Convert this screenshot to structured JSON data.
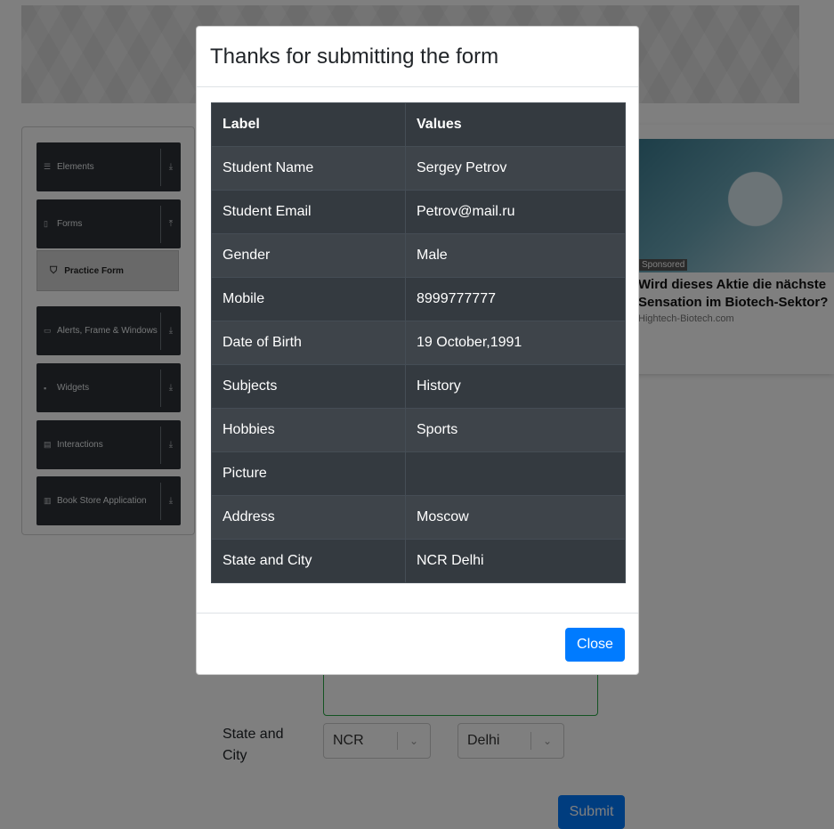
{
  "sidebar": {
    "groups": [
      {
        "label": "Elements",
        "icon": "hamburger-icon",
        "glyph": "☰",
        "arrow": "⤓"
      },
      {
        "label": "Forms",
        "icon": "document-icon",
        "glyph": "▯",
        "arrow": "⤒"
      },
      {
        "label": "Alerts, Frame & Windows",
        "icon": "window-icon",
        "glyph": "▭",
        "arrow": "⤓"
      },
      {
        "label": "Widgets",
        "icon": "grid-icon",
        "glyph": "▪",
        "arrow": "⤓"
      },
      {
        "label": "Interactions",
        "icon": "interactions-icon",
        "glyph": "▤",
        "arrow": "⤓"
      },
      {
        "label": "Book Store Application",
        "icon": "books-icon",
        "glyph": "▥",
        "arrow": "⤓"
      }
    ],
    "active_item": {
      "label": "Practice Form",
      "icon": "html5-icon",
      "glyph": "⛉"
    }
  },
  "ad": {
    "badge": "Sponsored",
    "title_line1": "Wird dieses Aktie die nächste",
    "title_line2": "Sensation im Biotech-Sektor?",
    "domain": "Hightech-Biotech.com"
  },
  "form": {
    "state_city_label": "State and City",
    "state_value": "NCR",
    "city_value": "Delhi",
    "submit_label": "Submit"
  },
  "modal": {
    "title": "Thanks for submitting the form",
    "columns": [
      "Label",
      "Values"
    ],
    "rows": [
      {
        "label": "Student Name",
        "value": "Sergey Petrov"
      },
      {
        "label": "Student Email",
        "value": "Petrov@mail.ru"
      },
      {
        "label": "Gender",
        "value": "Male"
      },
      {
        "label": "Mobile",
        "value": "8999777777"
      },
      {
        "label": "Date of Birth",
        "value": "19 October,1991"
      },
      {
        "label": "Subjects",
        "value": "History"
      },
      {
        "label": "Hobbies",
        "value": "Sports"
      },
      {
        "label": "Picture",
        "value": ""
      },
      {
        "label": "Address",
        "value": "Moscow"
      },
      {
        "label": "State and City",
        "value": "NCR Delhi"
      }
    ],
    "close_label": "Close"
  },
  "colors": {
    "primary": "#007bff",
    "table_dark": "#343a40",
    "sidebar_dark": "#2c3136",
    "textarea_border": "#28a745"
  }
}
